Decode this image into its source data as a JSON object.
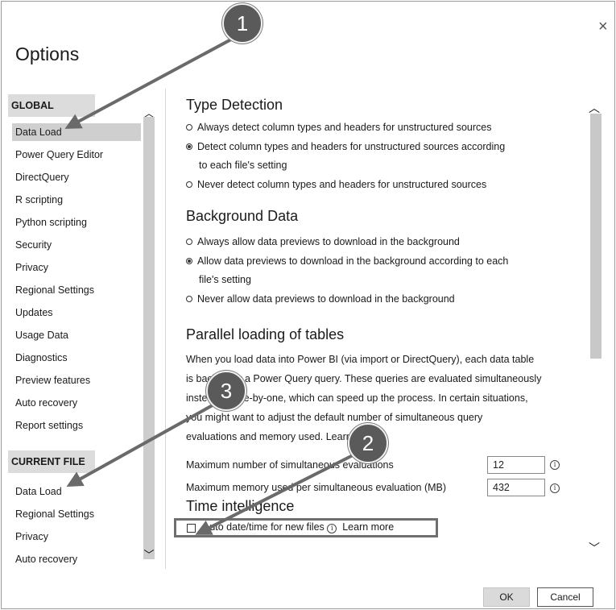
{
  "dialog": {
    "title": "Options",
    "close_glyph": "×"
  },
  "nav": {
    "global_header": "GLOBAL",
    "global_items": [
      "Data Load",
      "Power Query Editor",
      "DirectQuery",
      "R scripting",
      "Python scripting",
      "Security",
      "Privacy",
      "Regional Settings",
      "Updates",
      "Usage Data",
      "Diagnostics",
      "Preview features",
      "Auto recovery",
      "Report settings"
    ],
    "current_header": "CURRENT FILE",
    "current_items": [
      "Data Load",
      "Regional Settings",
      "Privacy",
      "Auto recovery"
    ]
  },
  "type_detection": {
    "heading": "Type Detection",
    "opt1": "Always detect column types and headers for unstructured sources",
    "opt2a": "Detect column types and headers for unstructured sources according",
    "opt2b": "to each file's setting",
    "opt3": "Never detect column types and headers for unstructured sources"
  },
  "background_data": {
    "heading": "Background Data",
    "opt1": "Always allow data previews to download in the background",
    "opt2a": "Allow data previews to download in the background according to each",
    "opt2b": "file's setting",
    "opt3": "Never allow data previews to download in the background"
  },
  "parallel": {
    "heading": "Parallel loading of tables",
    "p1": "When you load data into Power BI (via import or DirectQuery), each data table",
    "p2": "is backed by a Power Query query. These queries are evaluated simultaneously",
    "p3": "instead of one-by-one, which can speed up the process. In certain situations,",
    "p4": "you might want to adjust the default number of simultaneous query",
    "p5": "evaluations and memory used.",
    "learn_more": "Learn more",
    "max_evals_label": "Maximum number of simultaneous evaluations",
    "max_evals_value": "12",
    "max_mem_label": "Maximum memory used per simultaneous evaluation (MB)",
    "max_mem_value": "432"
  },
  "time_intel": {
    "heading": "Time intelligence",
    "checkbox_label": "Auto date/time for new files",
    "learn_more": "Learn more"
  },
  "buttons": {
    "ok": "OK",
    "cancel": "Cancel"
  },
  "annotations": {
    "one": "1",
    "two": "2",
    "three": "3"
  },
  "colors": {
    "badge": "#5a5a5a",
    "arrow": "#6a6a6a",
    "selected": "#cfcfcf"
  }
}
